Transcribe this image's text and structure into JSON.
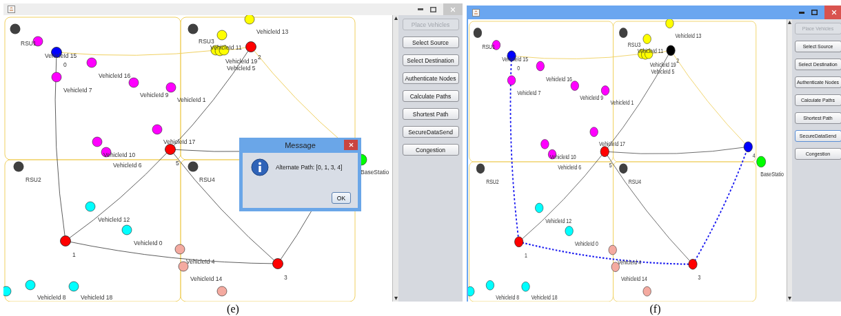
{
  "panels": [
    {
      "caption": "(e)",
      "window": {
        "active": false
      },
      "buttons": [
        {
          "label": "Place Vehicles",
          "disabled": true,
          "focused": false
        },
        {
          "label": "Select Source",
          "disabled": false,
          "focused": false
        },
        {
          "label": "Select Destination",
          "disabled": false,
          "focused": false
        },
        {
          "label": "Authenticate Nodes",
          "disabled": false,
          "focused": false
        },
        {
          "label": "Calculate Paths",
          "disabled": false,
          "focused": false
        },
        {
          "label": "Shortest Path",
          "disabled": false,
          "focused": false
        },
        {
          "label": "SecureDataSend",
          "disabled": false,
          "focused": false
        },
        {
          "label": "Congestion",
          "disabled": false,
          "focused": false
        }
      ],
      "nodes": [
        {
          "kind": "rsu",
          "color": "#404040",
          "label": "RSU1"
        },
        {
          "kind": "vehicle",
          "color": "#ff00ff"
        },
        {
          "kind": "router",
          "color": "#0000ff",
          "label": "VehicleId 15",
          "number": "0"
        },
        {
          "kind": "vehicle",
          "color": "#ff00ff",
          "label": "VehicleId 16"
        },
        {
          "kind": "vehicle",
          "color": "#ff00ff",
          "label": "VehicleId 7"
        },
        {
          "kind": "vehicle",
          "color": "#ff00ff",
          "label": "VehicleId 9"
        },
        {
          "kind": "vehicle",
          "color": "#ff00ff",
          "label": "VehicleId 1"
        },
        {
          "kind": "vehicle",
          "color": "#ff00ff"
        },
        {
          "kind": "vehicle",
          "color": "#ff00ff",
          "label": "VehicleId 10"
        },
        {
          "kind": "vehicle",
          "color": "#ff00ff",
          "label": "VehicleId 6"
        },
        {
          "kind": "router",
          "color": "#ff0000",
          "label": "VehicleId 17",
          "number": "5"
        },
        {
          "kind": "rsu",
          "color": "#404040",
          "label": "RSU3"
        },
        {
          "kind": "vehicle",
          "color": "#ffff00"
        },
        {
          "kind": "vehicle",
          "color": "#ffff00",
          "label": "VehicleId 13"
        },
        {
          "kind": "vehicle",
          "color": "#ffff00",
          "label": "VehicleId 11"
        },
        {
          "kind": "vehicle",
          "color": "#ffff00",
          "label": "VehicleId 19"
        },
        {
          "kind": "vehicle",
          "color": "#ffff00",
          "label": "VehicleId 5"
        },
        {
          "kind": "router",
          "color": "#ff0000",
          "number": "2"
        },
        {
          "kind": "base",
          "color": "#00ff00",
          "label": "BaseStatio"
        },
        {
          "kind": "rsu",
          "color": "#404040",
          "label": "RSU2"
        },
        {
          "kind": "rsu",
          "color": "#404040",
          "label": "RSU4"
        },
        {
          "kind": "vehicle",
          "color": "#00ffff",
          "label": "VehicleId 12"
        },
        {
          "kind": "vehicle",
          "color": "#00ffff",
          "label": "VehicleId 0"
        },
        {
          "kind": "router",
          "color": "#ff0000",
          "number": "1"
        },
        {
          "kind": "vehicle",
          "color": "#f4aaa0",
          "label": "VehicleId 4"
        },
        {
          "kind": "vehicle",
          "color": "#f4aaa0",
          "label": "VehicleId 14"
        },
        {
          "kind": "router",
          "color": "#ff0000",
          "number": "3"
        },
        {
          "kind": "vehicle",
          "color": "#00ffff"
        },
        {
          "kind": "vehicle",
          "color": "#00ffff",
          "label": "VehicleId 8"
        },
        {
          "kind": "vehicle",
          "color": "#00ffff",
          "label": "VehicleId 18"
        },
        {
          "kind": "vehicle",
          "color": "#f4aaa0"
        }
      ],
      "edges": [
        {
          "kind": "road"
        },
        {
          "kind": "road"
        },
        {
          "kind": "road"
        },
        {
          "kind": "link"
        },
        {
          "kind": "link"
        },
        {
          "kind": "link"
        },
        {
          "kind": "link"
        },
        {
          "kind": "link"
        },
        {
          "kind": "link"
        },
        {
          "kind": "link"
        }
      ],
      "dialog": {
        "title": "Message",
        "message": "Alternate Path: [0, 1, 3, 4]",
        "button": "OK"
      }
    },
    {
      "caption": "(f)",
      "window": {
        "active": true
      },
      "buttons": [
        {
          "label": "Place Vehicles",
          "disabled": true,
          "focused": false
        },
        {
          "label": "Select Source",
          "disabled": false,
          "focused": false
        },
        {
          "label": "Select Destination",
          "disabled": false,
          "focused": false
        },
        {
          "label": "Authenticate Nodes",
          "disabled": false,
          "focused": false
        },
        {
          "label": "Calculate Paths",
          "disabled": false,
          "focused": false
        },
        {
          "label": "Shortest Path",
          "disabled": false,
          "focused": false
        },
        {
          "label": "SecureDataSend",
          "disabled": false,
          "focused": true
        },
        {
          "label": "Congestion",
          "disabled": false,
          "focused": false
        }
      ],
      "nodes": [
        {
          "kind": "rsu",
          "color": "#404040",
          "label": "RSU1"
        },
        {
          "kind": "vehicle",
          "color": "#ff00ff"
        },
        {
          "kind": "router",
          "color": "#0000ff",
          "label": "VehicleId 15",
          "number": "0"
        },
        {
          "kind": "vehicle",
          "color": "#ff00ff",
          "label": "VehicleId 16"
        },
        {
          "kind": "vehicle",
          "color": "#ff00ff",
          "label": "VehicleId 7"
        },
        {
          "kind": "vehicle",
          "color": "#ff00ff",
          "label": "VehicleId 9"
        },
        {
          "kind": "vehicle",
          "color": "#ff00ff",
          "label": "VehicleId 1"
        },
        {
          "kind": "vehicle",
          "color": "#ff00ff"
        },
        {
          "kind": "vehicle",
          "color": "#ff00ff",
          "label": "VehicleId 10"
        },
        {
          "kind": "vehicle",
          "color": "#ff00ff",
          "label": "VehicleId 6"
        },
        {
          "kind": "router",
          "color": "#ff0000",
          "label": "VehicleId 17",
          "number": "5"
        },
        {
          "kind": "rsu",
          "color": "#404040",
          "label": "RSU3"
        },
        {
          "kind": "vehicle",
          "color": "#ffff00"
        },
        {
          "kind": "vehicle",
          "color": "#ffff00",
          "label": "VehicleId 13"
        },
        {
          "kind": "vehicle",
          "color": "#ffff00",
          "label": "VehicleId 11"
        },
        {
          "kind": "vehicle",
          "color": "#ffff00",
          "label": "VehicleId 19"
        },
        {
          "kind": "vehicle",
          "color": "#ffff00",
          "label": "VehicleId 5"
        },
        {
          "kind": "router",
          "color": "#000000",
          "number": "2"
        },
        {
          "kind": "base",
          "color": "#00ff00",
          "label": "BaseStatio"
        },
        {
          "kind": "rsu",
          "color": "#404040",
          "label": "RSU2"
        },
        {
          "kind": "rsu",
          "color": "#404040",
          "label": "RSU4"
        },
        {
          "kind": "vehicle",
          "color": "#00ffff",
          "label": "VehicleId 12"
        },
        {
          "kind": "vehicle",
          "color": "#00ffff",
          "label": "VehicleId 0"
        },
        {
          "kind": "router",
          "color": "#ff0000",
          "number": "1"
        },
        {
          "kind": "vehicle",
          "color": "#f4aaa0",
          "label": "VehicleId 4"
        },
        {
          "kind": "vehicle",
          "color": "#f4aaa0",
          "label": "VehicleId 14"
        },
        {
          "kind": "router",
          "color": "#ff0000",
          "number": "3"
        },
        {
          "kind": "vehicle",
          "color": "#00ffff"
        },
        {
          "kind": "vehicle",
          "color": "#00ffff",
          "label": "VehicleId 8"
        },
        {
          "kind": "vehicle",
          "color": "#00ffff",
          "label": "VehicleId 18"
        },
        {
          "kind": "vehicle",
          "color": "#f4aaa0"
        },
        {
          "kind": "router",
          "color": "#0000ff",
          "number": "4"
        }
      ],
      "edges": [
        {
          "kind": "road"
        },
        {
          "kind": "road"
        },
        {
          "kind": "road"
        },
        {
          "kind": "path"
        },
        {
          "kind": "link"
        },
        {
          "kind": "link"
        },
        {
          "kind": "link"
        },
        {
          "kind": "link"
        },
        {
          "kind": "path"
        },
        {
          "kind": "path"
        }
      ]
    }
  ]
}
